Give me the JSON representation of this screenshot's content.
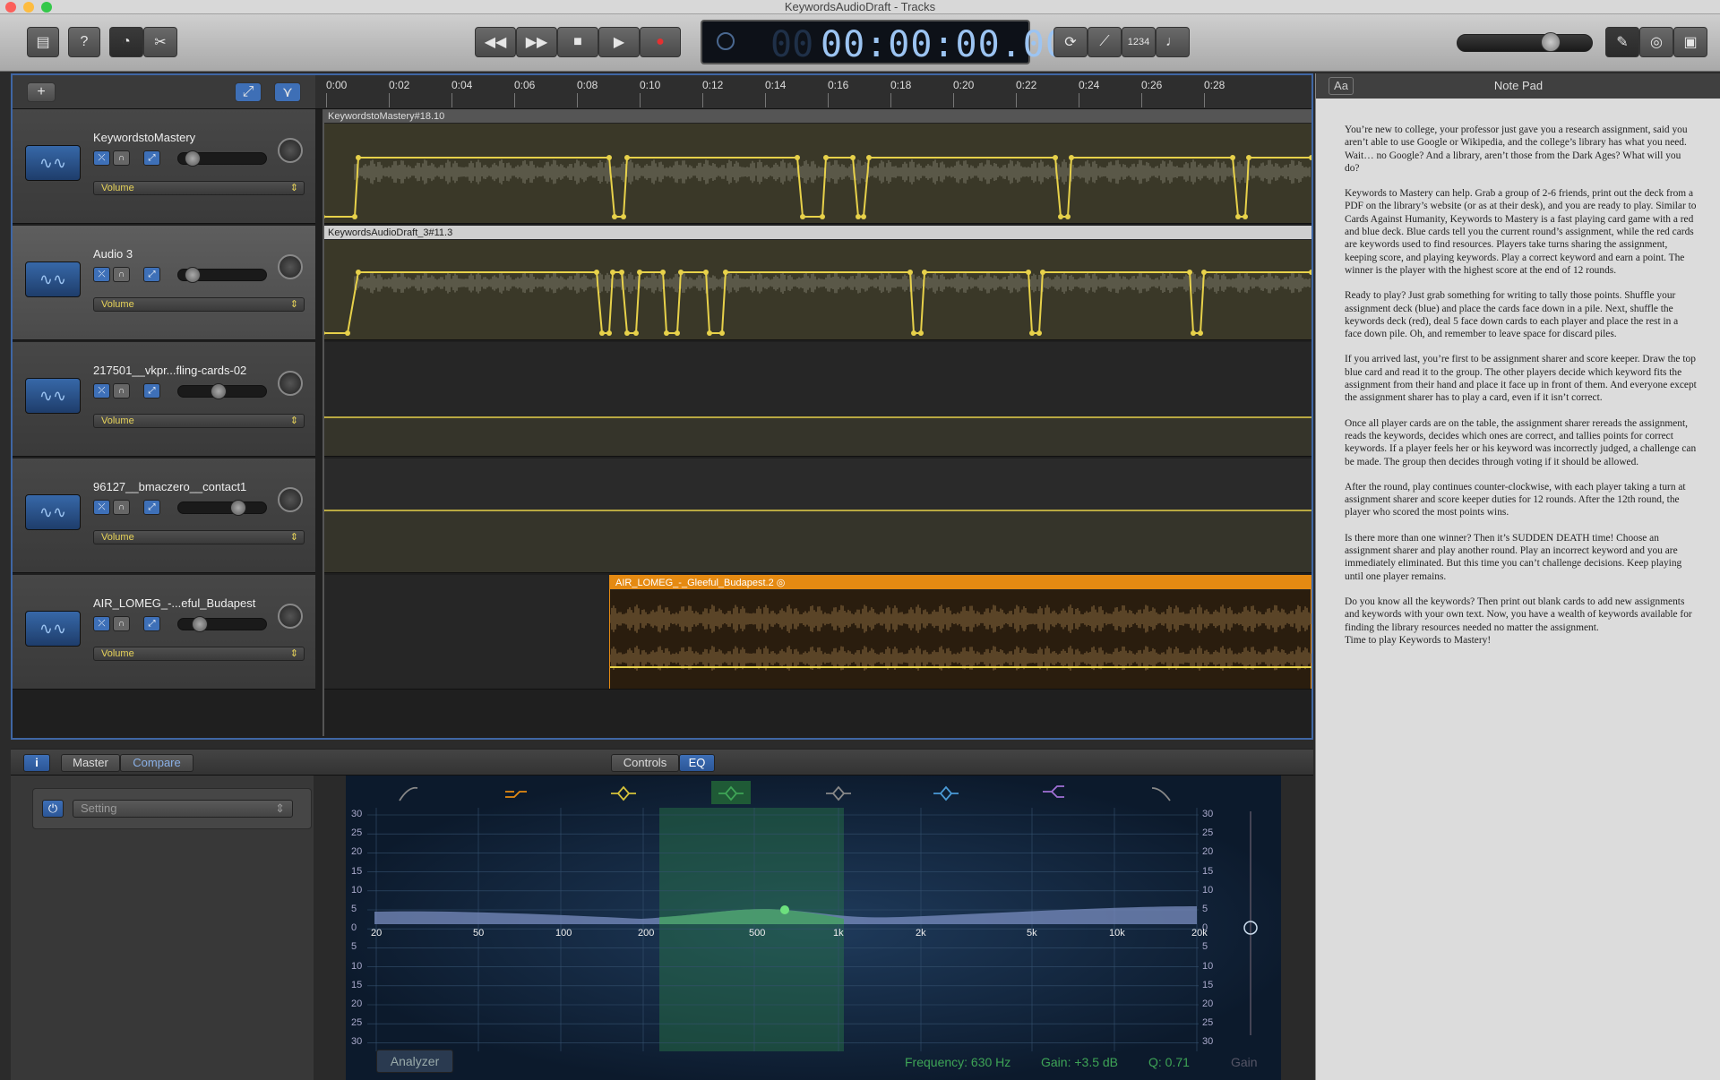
{
  "window": {
    "title": "KeywordsAudioDraft - Tracks"
  },
  "toolbar": {
    "time_dim": "00",
    "time": "00:00:00.00",
    "count_in": "1234",
    "icons": [
      "library-icon",
      "help-icon",
      "smart-controls-icon",
      "editors-icon",
      "rewind-icon",
      "fast-forward-icon",
      "stop-icon",
      "play-icon",
      "record-icon",
      "cycle-icon",
      "tuner-icon",
      "count-in-icon",
      "metronome-icon",
      "notepad-icon",
      "loop-browser-icon",
      "media-browser-icon"
    ]
  },
  "ruler": {
    "ticks": [
      "0:00",
      "0:02",
      "0:04",
      "0:06",
      "0:08",
      "0:10",
      "0:12",
      "0:14",
      "0:16",
      "0:18",
      "0:20",
      "0:22",
      "0:24",
      "0:26",
      "0:28"
    ]
  },
  "tracks": [
    {
      "name": "KeywordstoMastery",
      "automation": "Volume",
      "region": "KeywordstoMastery#18.10",
      "volume": 0.1,
      "selected": false
    },
    {
      "name": "Audio 3",
      "automation": "Volume",
      "region": "KeywordsAudioDraft_3#11.3",
      "volume": 0.1,
      "selected": true
    },
    {
      "name": "217501__vkpr...fling-cards-02",
      "automation": "Volume",
      "region": "",
      "volume": 0.45,
      "selected": false
    },
    {
      "name": "96127__bmaczero__contact1",
      "automation": "Volume",
      "region": "",
      "volume": 0.72,
      "selected": false
    },
    {
      "name": "AIR_LOMEG_-...eful_Budapest",
      "automation": "Volume",
      "region": "AIR_LOMEG_-_Gleeful_Budapest.2",
      "volume": 0.2,
      "selected": false
    }
  ],
  "colors": {
    "accent": "#3f66a4",
    "automation": "#e7d14a",
    "region_orange": "#e58a12",
    "eq_green": "#3ea456"
  },
  "notepad": {
    "title": "Note Pad",
    "aa": "Aa",
    "paragraphs": [
      "You’re new to college, your professor just gave you a research assignment, said you aren’t able to use Google or Wikipedia, and the college’s library has what you need. Wait… no Google? And a library, aren’t those from the Dark Ages? What will you do?",
      "Keywords to Mastery can help. Grab a group of 2-6 friends, print out the deck from a PDF on the library’s website (or as at their desk), and you are ready to play. Similar to Cards Against Humanity, Keywords to Mastery is a fast playing card game with a red and blue deck. Blue cards tell you the current round’s assignment, while the red cards are keywords used to find resources. Players take turns sharing the assignment, keeping score, and playing keywords. Play a correct keyword and earn a point. The winner is the player with the highest score at the end of 12 rounds.",
      "Ready to play? Just grab something for writing to tally those points. Shuffle your assignment deck (blue) and place the cards face down in a pile. Next, shuffle the keywords deck (red), deal 5 face down cards to each player and place the rest in a face down pile. Oh, and remember to leave space for discard piles.",
      "If you arrived last, you’re first to be assignment sharer and score keeper. Draw the top blue card and read it to the group. The other players decide which keyword fits the assignment from their hand and place it face up in front of them. And everyone except the assignment sharer has to play a card, even if it isn’t correct.",
      "Once all player cards are on the table, the assignment sharer rereads the assignment, reads the keywords, decides which ones are correct, and tallies points for correct keywords. If a player feels her or his keyword was incorrectly judged, a challenge can be made. The group then decides through voting if it should be allowed.",
      "After the round, play continues counter-clockwise, with each player taking a turn at assignment sharer and score keeper duties for 12 rounds. After the 12th round, the player who scored the most points wins.",
      "Is there more than one winner? Then it’s SUDDEN DEATH time! Choose an assignment sharer and play another round. Play an incorrect keyword and you are immediately eliminated. But this time you can’t challenge decisions. Keep playing until one player remains.",
      "Do you know all the keywords? Then print out blank cards to add new assignments and keywords with your own text. Now, you have a wealth of keywords available for finding the library resources needed no matter the assignment.\nTime to play Keywords to Mastery!"
    ]
  },
  "smart_controls": {
    "info": "i",
    "master": "Master",
    "compare": "Compare",
    "controls_tab": "Controls",
    "eq_tab": "EQ",
    "setting": "Setting"
  },
  "eq": {
    "freq_labels": [
      "20",
      "50",
      "100",
      "200",
      "500",
      "1k",
      "2k",
      "5k",
      "10k",
      "20k"
    ],
    "db_labels": [
      "30",
      "25",
      "20",
      "15",
      "10",
      "5",
      "0",
      "5",
      "10",
      "15",
      "20",
      "25",
      "30"
    ],
    "analyzer": "Analyzer",
    "frequency": "Frequency: 630 Hz",
    "gain": "Gain: +3.5 dB",
    "q": "Q: 0.71",
    "gain_label": "Gain",
    "band_colors": [
      "#888888",
      "#e58a12",
      "#d6c23a",
      "#3ea456",
      "#888888",
      "#4a9ad6",
      "#a070d6",
      "#888888"
    ]
  }
}
